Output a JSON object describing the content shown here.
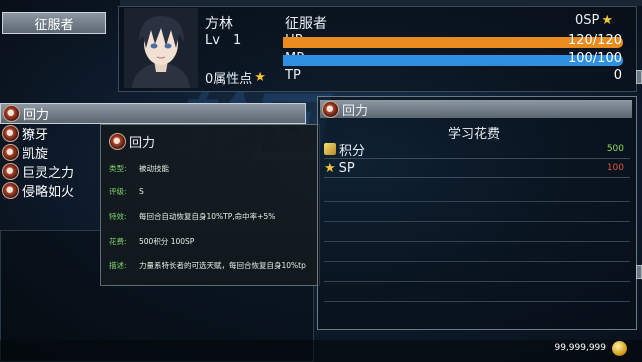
{
  "header": {
    "class_tab": "征服者",
    "name": "方林",
    "level_label": "Lv",
    "level_value": "1",
    "attr_points": "0属性点",
    "class_name": "征服者",
    "sp": "0SP",
    "bars": [
      {
        "label": "HP",
        "value": "120/120",
        "fill": 1.0,
        "color": "#e98b1d"
      },
      {
        "label": "MP",
        "value": "100/100",
        "fill": 1.0,
        "color": "#2f8fe0"
      },
      {
        "label": "TP",
        "value": "0",
        "fill": 0.0,
        "color": "#2a3442"
      }
    ]
  },
  "skills": [
    {
      "label": "回力",
      "selected": true
    },
    {
      "label": "獠牙"
    },
    {
      "label": "凯旋"
    },
    {
      "label": "巨灵之力"
    },
    {
      "label": "侵略如火"
    }
  ],
  "tooltip": {
    "title": "回力",
    "rows": [
      {
        "key": "类型:",
        "value": "被动技能"
      },
      {
        "key": "评级:",
        "value": "S"
      },
      {
        "key": "特效:",
        "value": "每回合自动恢复自身10%TP,命中率+5%"
      },
      {
        "key": "花费:",
        "value": "500积分 100SP"
      },
      {
        "key": "描述:",
        "value": "力量系特长者的可选天赋，每回合恢复自身10%tp"
      }
    ]
  },
  "detail": {
    "title": "回力",
    "cost_title": "学习花费",
    "costs": [
      {
        "label": "积分",
        "value": "500",
        "color": "#8fdc55"
      },
      {
        "label": "SP",
        "value": "100",
        "color": "#e0563a"
      }
    ]
  },
  "footer": {
    "money": "99,999,999"
  }
}
